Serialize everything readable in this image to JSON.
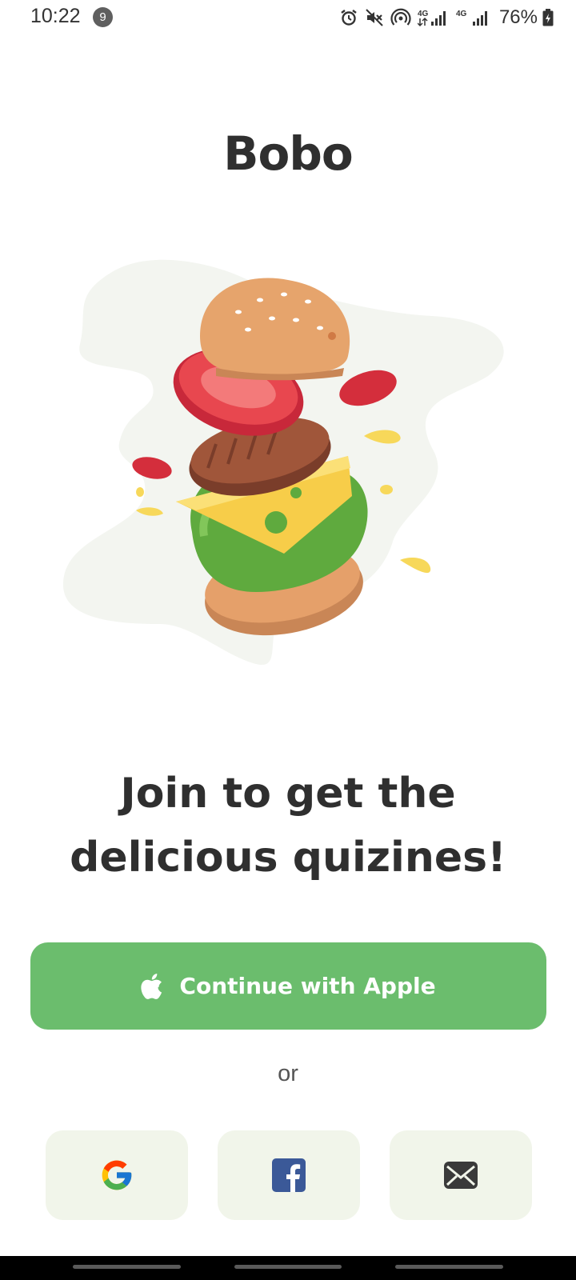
{
  "status_bar": {
    "time": "10:22",
    "notification_count": "9",
    "network_1": "4G",
    "network_2": "4G",
    "battery": "76%"
  },
  "logo": {
    "text": "Bobo"
  },
  "headline": {
    "line1": "Join to get the",
    "line2": "delicious quizines!"
  },
  "apple_button": {
    "label": "Continue with Apple",
    "icon": "apple-icon",
    "color": "#6bbd6d"
  },
  "divider": {
    "text": "or"
  },
  "social_buttons": [
    {
      "icon": "google-icon"
    },
    {
      "icon": "facebook-icon"
    },
    {
      "icon": "mail-icon"
    }
  ],
  "colors": {
    "accent": "#6bbd6d",
    "social_bg": "#f1f5ea",
    "text": "#2f2f2f"
  }
}
